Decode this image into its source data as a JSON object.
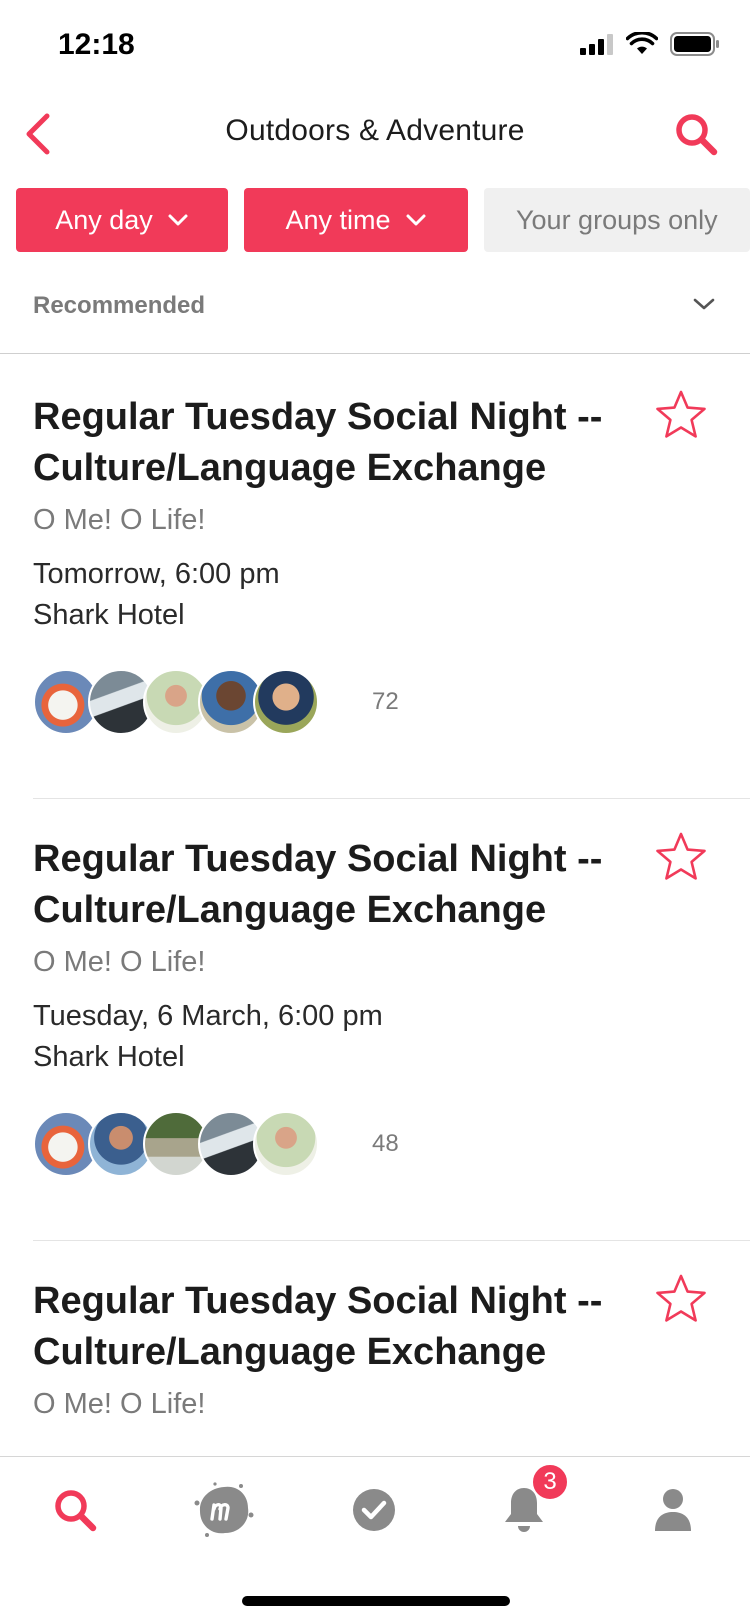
{
  "status_bar": {
    "time": "12:18"
  },
  "header": {
    "title": "Outdoors & Adventure",
    "back_icon": "chevron-left-icon",
    "search_icon": "search-icon"
  },
  "filters": [
    {
      "label": "Any day",
      "active": true
    },
    {
      "label": "Any time",
      "active": true
    },
    {
      "label": "Your groups only",
      "active": false
    }
  ],
  "sort": {
    "label": "Recommended"
  },
  "events": [
    {
      "title": "Regular Tuesday Social Night -- Culture/Language Exchange",
      "group": "O Me! O Life!",
      "date": "Tomorrow, 6:00 pm",
      "venue": "Shark Hotel",
      "attendee_count": "72"
    },
    {
      "title": "Regular Tuesday Social Night -- Culture/Language Exchange",
      "group": "O Me! O Life!",
      "date": "Tuesday, 6 March, 6:00 pm",
      "venue": "Shark Hotel",
      "attendee_count": "48"
    },
    {
      "title": "Regular Tuesday Social Night -- Culture/Language Exchange",
      "group": "O Me! O Life!",
      "date": "",
      "venue": "",
      "attendee_count": ""
    }
  ],
  "tab_bar": {
    "tabs": [
      "search-icon",
      "meetup-logo-icon",
      "check-circle-icon",
      "bell-icon",
      "profile-icon"
    ],
    "notification_badge": "3"
  },
  "colors": {
    "accent": "#f13a59",
    "text": "#1c1c1c",
    "muted": "#7a7a7a",
    "chip_inactive_bg": "#f0f0f0"
  }
}
